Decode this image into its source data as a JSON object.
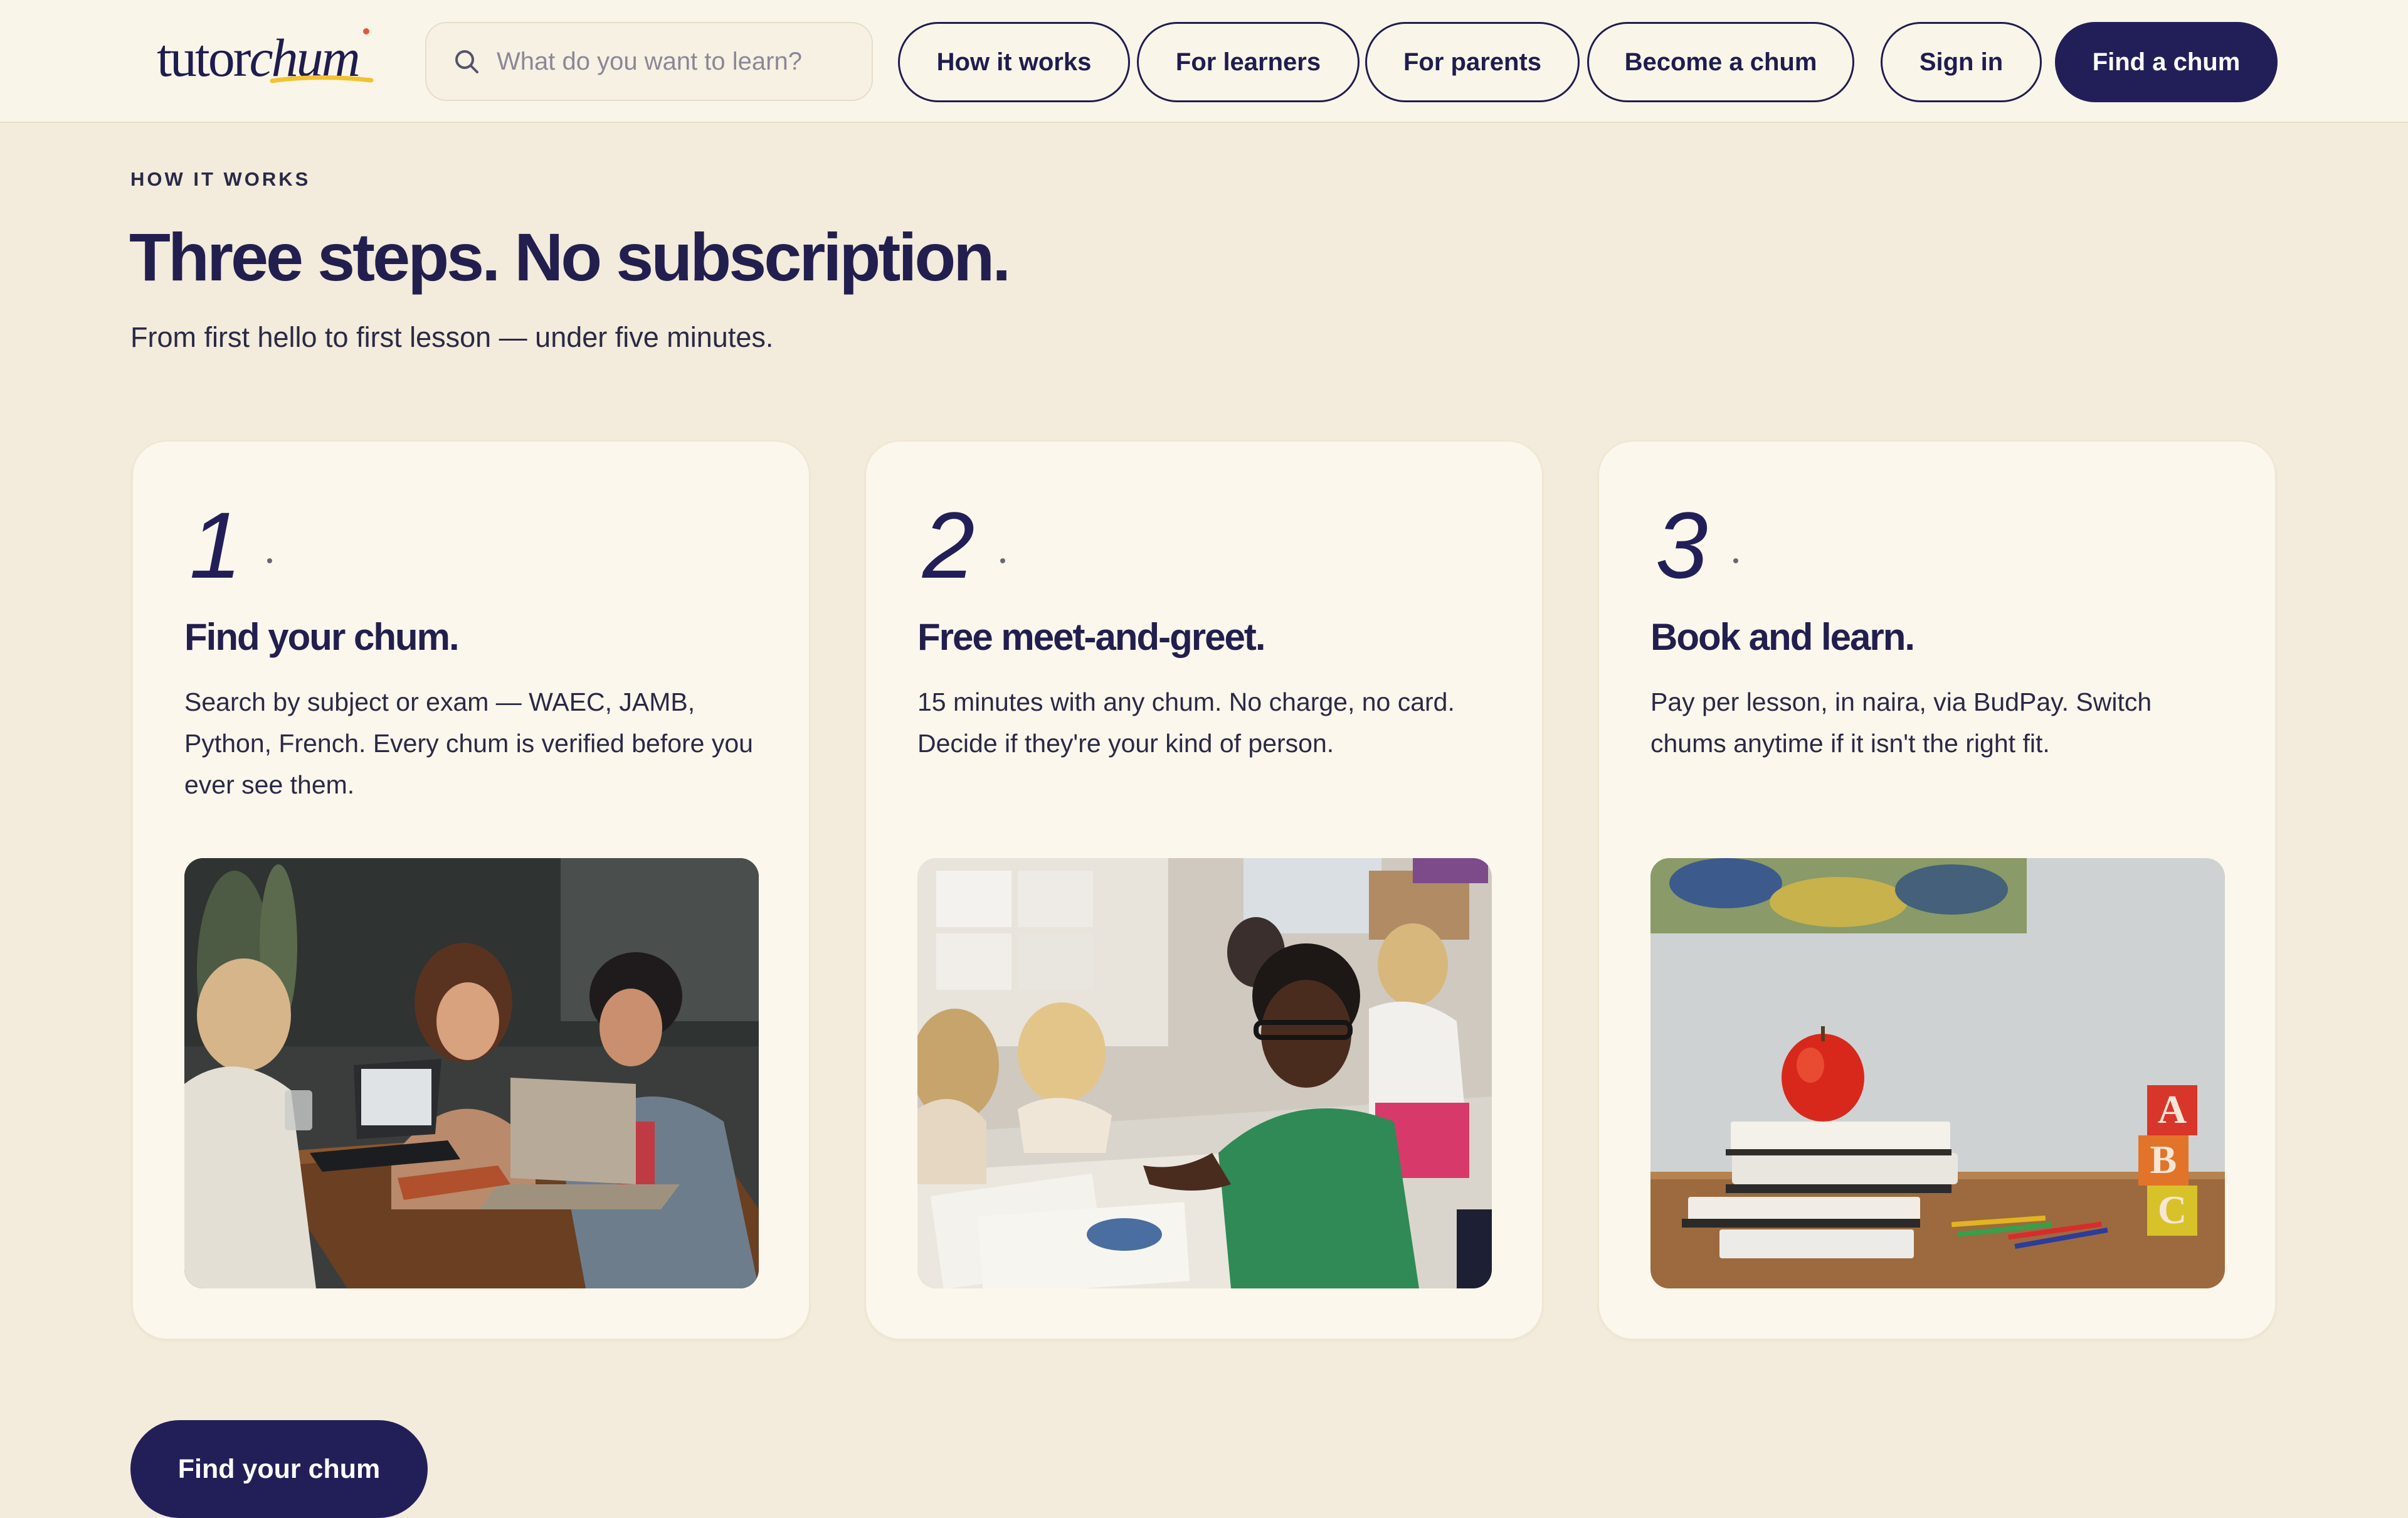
{
  "header": {
    "logo": {
      "part1": "tutor",
      "part2": "chum"
    },
    "search": {
      "placeholder": "What do you want to learn?"
    },
    "nav": [
      {
        "label": "How it works"
      },
      {
        "label": "For learners"
      },
      {
        "label": "For parents"
      },
      {
        "label": "Become a chum"
      }
    ],
    "sign_in_label": "Sign in",
    "find_chum_label": "Find a chum"
  },
  "section": {
    "eyebrow": "HOW IT WORKS",
    "headline": "Three steps. No subscription.",
    "subhead": "From first hello to first lesson — under five minutes."
  },
  "steps": [
    {
      "number": "1",
      "title": "Find your chum.",
      "text": "Search by subject or exam — WAEC, JAMB, Python, French. Every chum is verified before you ever see them.",
      "image": "photo-friends-studying-with-laptops"
    },
    {
      "number": "2",
      "title": "Free meet-and-greet.",
      "text": "15 minutes with any chum. No charge, no card. Decide if they're your kind of person.",
      "image": "photo-children-drawing-in-classroom"
    },
    {
      "number": "3",
      "title": "Book and learn.",
      "text": "Pay per lesson, in naira, via BudPay. Switch chums anytime if it isn't the right fit.",
      "image": "photo-apple-on-books-with-abc-blocks"
    }
  ],
  "cta": {
    "label": "Find your chum"
  },
  "colors": {
    "brand_navy": "#221f58",
    "page_background": "#f3ebdb",
    "header_background": "#faf5e9",
    "card_background": "#fcf7ec",
    "logo_accent_yellow": "#f2c230",
    "logo_accent_red": "#e2583f"
  },
  "icons": {
    "search": "search-icon"
  }
}
